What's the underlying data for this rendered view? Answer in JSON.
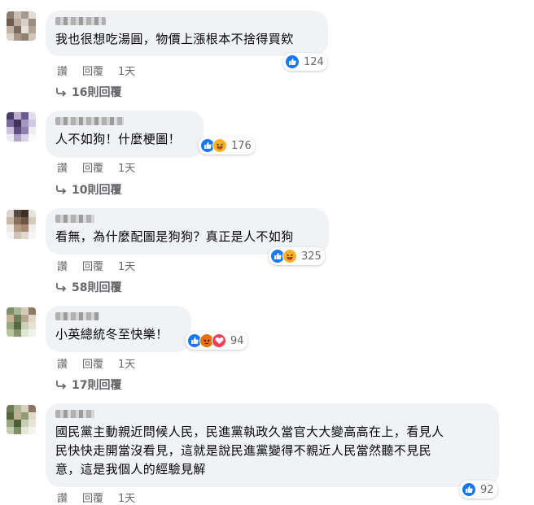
{
  "actions": {
    "read": "讚",
    "reply": "回覆",
    "time": "1天"
  },
  "comments": [
    {
      "text": "我也很想吃湯圓，物價上漲根本不捨得買欸",
      "reaction_count": "124",
      "reactions": [
        "like-icon"
      ],
      "replies_label": "16則回覆"
    },
    {
      "text": "人不如狗！什麼梗圖！",
      "reaction_count": "176",
      "reactions": [
        "like-icon",
        "haha-icon"
      ],
      "replies_label": "10則回覆"
    },
    {
      "text": "看無，為什麼配圖是狗狗？真正是人不如狗",
      "reaction_count": "325",
      "reactions": [
        "like-icon",
        "haha-icon"
      ],
      "replies_label": "58則回覆"
    },
    {
      "text": "小英總統冬至快樂！",
      "reaction_count": "94",
      "reactions": [
        "like-icon",
        "angry-icon",
        "love-icon"
      ],
      "replies_label": "17則回覆"
    },
    {
      "text": "國民黨主動親近問候人民，民進黨執政久當官大大變高高在上，看見人\n民快快走開當沒看見，這就是說民進黨變得不親近人民當然聽不見民\n意，這是我個人的經驗見解",
      "reaction_count": "92",
      "reactions": [
        "like-icon"
      ],
      "replies_label": ""
    }
  ],
  "colors": {
    "like": "#1877f2",
    "bubble": "#f0f2f5",
    "meta": "#65676b"
  }
}
